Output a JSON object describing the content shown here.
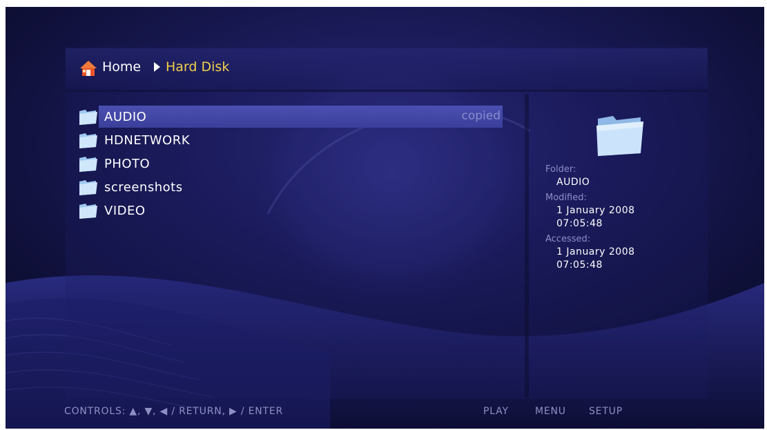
{
  "breadcrumb": {
    "home_label": "Home",
    "current_label": "Hard Disk"
  },
  "file_list": {
    "items": [
      {
        "label": "AUDIO",
        "status": "copied",
        "selected": true
      },
      {
        "label": "HDNETWORK",
        "status": "",
        "selected": false
      },
      {
        "label": "PHOTO",
        "status": "",
        "selected": false
      },
      {
        "label": "screenshots",
        "status": "",
        "selected": false
      },
      {
        "label": "VIDEO",
        "status": "",
        "selected": false
      }
    ]
  },
  "info": {
    "folder_label": "Folder:",
    "folder_value": "AUDIO",
    "modified_label": "Modified:",
    "modified_date": "1 January 2008",
    "modified_time": "07:05:48",
    "accessed_label": "Accessed:",
    "accessed_date": "1 January 2008",
    "accessed_time": "07:05:48"
  },
  "controls": {
    "hint_text": "CONTROLS:  ▲, ▼, ◀ / RETURN, ▶ / ENTER",
    "play_label": "PLAY",
    "menu_label": "MENU",
    "setup_label": "SETUP"
  },
  "colors": {
    "accent_current": "#f2d04a",
    "selection": "#4b4fb0",
    "background": "#1a1a58"
  },
  "icons": {
    "home": "home-icon",
    "folder": "folder-icon",
    "separator": "chevron-right-icon"
  }
}
